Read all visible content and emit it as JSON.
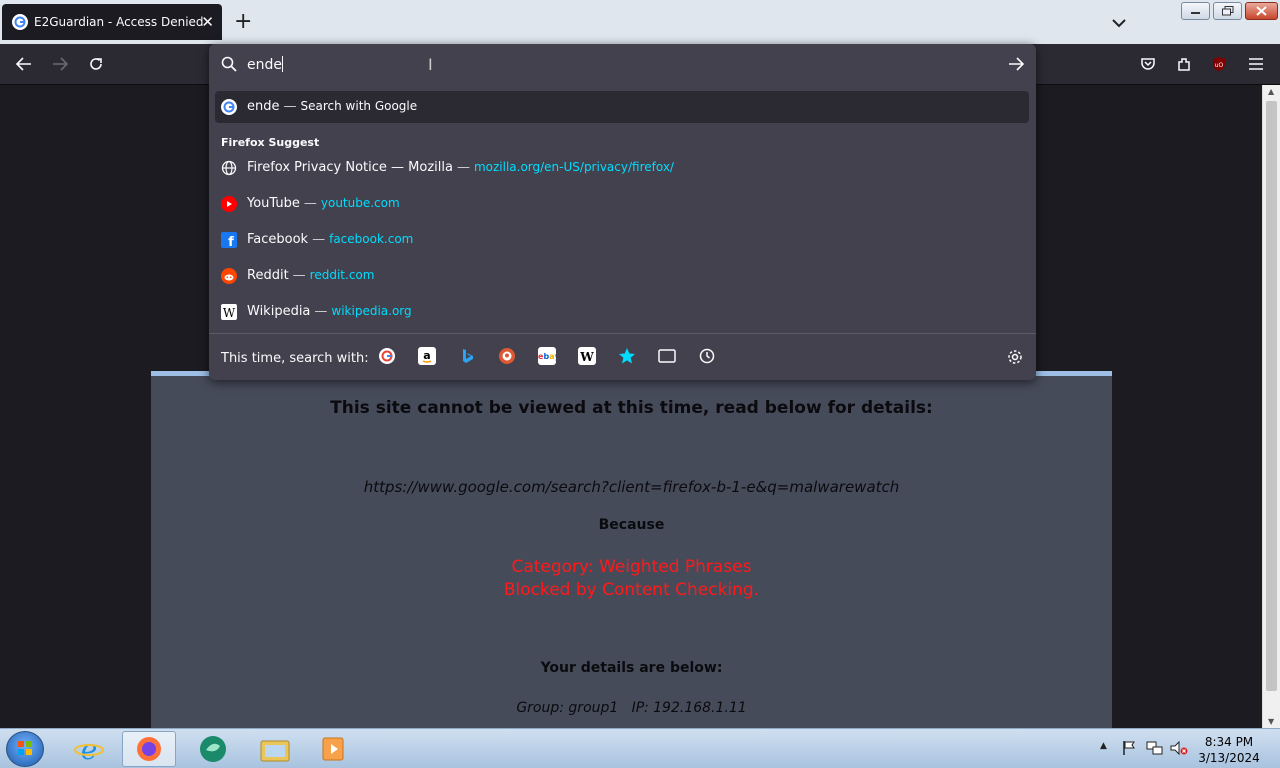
{
  "tab": {
    "title": "E2Guardian - Access Denied"
  },
  "urlbar": {
    "value": "ende",
    "search_suggestion": {
      "query": "ende",
      "action": "Search with Google"
    },
    "group_label": "Firefox Suggest",
    "suggestions": [
      {
        "title": "Firefox Privacy Notice — Mozilla",
        "url": "mozilla.org/en-US/privacy/firefox/",
        "icon": "globe-icon"
      },
      {
        "title": "YouTube",
        "url": "youtube.com",
        "icon": "youtube-icon"
      },
      {
        "title": "Facebook",
        "url": "facebook.com",
        "icon": "facebook-icon"
      },
      {
        "title": "Reddit",
        "url": "reddit.com",
        "icon": "reddit-icon"
      },
      {
        "title": "Wikipedia",
        "url": "wikipedia.org",
        "icon": "wikipedia-icon"
      }
    ],
    "oneoff_label": "This time, search with:",
    "engines": [
      "google",
      "amazon",
      "bing",
      "duckduckgo",
      "ebay",
      "wikipedia",
      "bookmarks",
      "tabs",
      "history"
    ]
  },
  "page": {
    "heading": "This site cannot be viewed at this time, read below for details:",
    "blocked_url": "https://www.google.com/search?client=firefox-b-1-e&q=malwarewatch",
    "because": "Because",
    "category_line1": "Category: Weighted Phrases",
    "category_line2": "Blocked by Content Checking.",
    "details_heading": "Your details are below:",
    "details": "Group: group1   IP: 192.168.1.11"
  },
  "taskbar": {
    "clock_time": "8:34 PM",
    "clock_date": "3/13/2024"
  },
  "colors": {
    "accent_url": "#00ddff",
    "block_red": "#ff1a1a",
    "panel_bg": "#464b5a"
  }
}
